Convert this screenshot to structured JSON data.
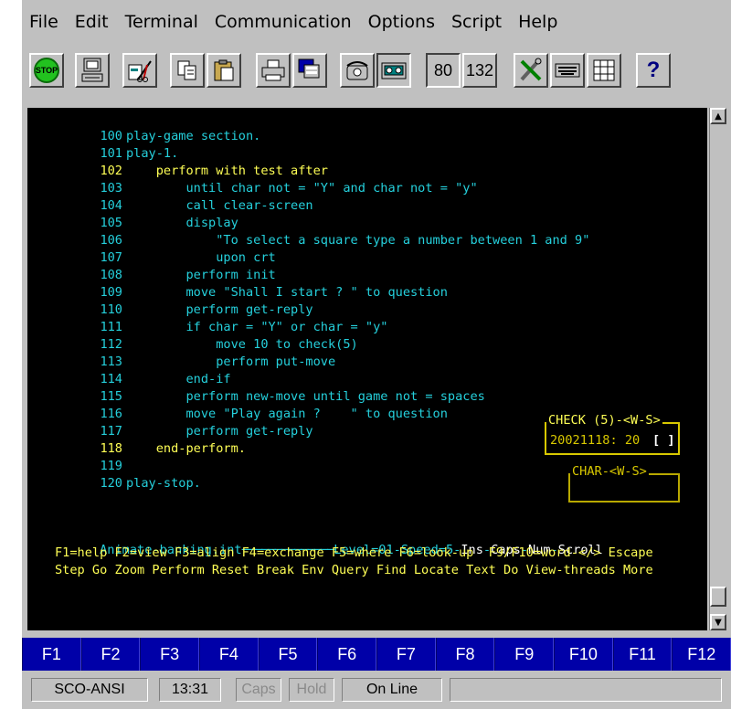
{
  "menu": {
    "file": "File",
    "edit": "Edit",
    "terminal": "Terminal",
    "communication": "Communication",
    "options": "Options",
    "script": "Script",
    "help": "Help"
  },
  "toolbar": {
    "stop_label": "STOP",
    "cols80": "80",
    "cols132": "132",
    "help_label": "?"
  },
  "code_lines": [
    {
      "num": "100",
      "text": "play-game section."
    },
    {
      "num": "101",
      "text": "play-1."
    },
    {
      "num": "102",
      "text": "    perform with test after"
    },
    {
      "num": "103",
      "text": "        until char not = \"Y\" and char not = \"y\""
    },
    {
      "num": "104",
      "text": "        call clear-screen"
    },
    {
      "num": "105",
      "text": "        display"
    },
    {
      "num": "106",
      "text": "            \"To select a square type a number between 1 and 9\""
    },
    {
      "num": "107",
      "text": "            upon crt"
    },
    {
      "num": "108",
      "text": "        perform init"
    },
    {
      "num": "109",
      "text": "        move \"Shall I start ? \" to question"
    },
    {
      "num": "110",
      "text": "        perform get-reply"
    },
    {
      "num": "111",
      "text": "        if char = \"Y\" or char = \"y\""
    },
    {
      "num": "112",
      "text": "            move 10 to check(5)"
    },
    {
      "num": "113",
      "text": "            perform put-move"
    },
    {
      "num": "114",
      "text": "        end-if"
    },
    {
      "num": "115",
      "text": "        perform new-move until game not = spaces"
    },
    {
      "num": "116",
      "text": "        move \"Play again ?    \" to question"
    },
    {
      "num": "117",
      "text": "        perform get-reply"
    },
    {
      "num": "118",
      "text": "    end-perform."
    },
    {
      "num": "119",
      "text": ""
    },
    {
      "num": "120",
      "text": "play-stop."
    }
  ],
  "monitor_check": {
    "title": "CHECK (5)-<W-S>",
    "value": "20021118: 20",
    "bracket": "[ ]"
  },
  "monitor_char": {
    "title": "CHAR-<W-S>"
  },
  "status_line": {
    "filename": "Animate-banking.int",
    "info": "Level=01-Speed=5-",
    "ins": "Ins",
    "caps": "Caps",
    "num": "Num",
    "scroll": "Scroll"
  },
  "key_line": "F1=help F2=view F3=align F4=exchange F5=where F6=look-up  F9/F10=word-</> Escape",
  "cmd_line": "Step Go Zoom Perform Reset Break Env Query Find Locate Text Do View-threads More",
  "fkeys": [
    "F1",
    "F2",
    "F3",
    "F4",
    "F5",
    "F6",
    "F7",
    "F8",
    "F9",
    "F10",
    "F11",
    "F12"
  ],
  "statusbar": {
    "emulation": "SCO-ANSI",
    "time": "13:31",
    "caps": "Caps",
    "hold": "Hold",
    "online": "On Line"
  },
  "colors": {
    "code": "#25d0dc",
    "highlight": "#ffff55",
    "fkey_bg": "#0000a8",
    "terminal_bg": "#000000"
  }
}
